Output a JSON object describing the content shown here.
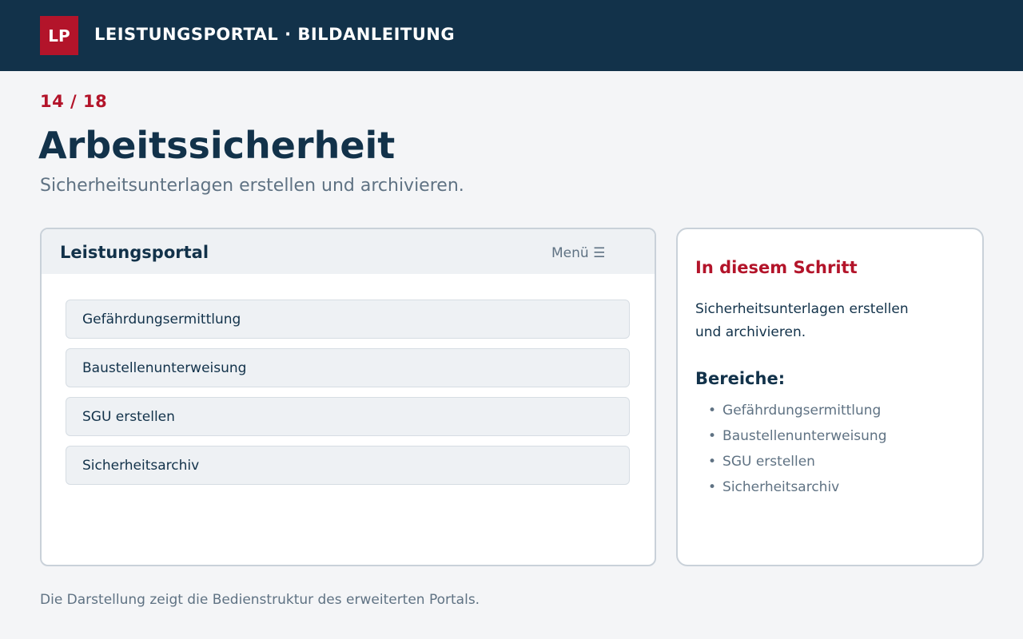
{
  "header": {
    "logo_text": "LP",
    "brand_title": "LEISTUNGSPORTAL · BILDANLEITUNG"
  },
  "step": {
    "counter": "14 / 18",
    "title": "Arbeitssicherheit",
    "subtitle": "Sicherheitsunterlagen erstellen und archivieren."
  },
  "portal": {
    "title": "Leistungsportal",
    "menu_label": "Menü ☰",
    "items": [
      {
        "label": "Gefährdungsermittlung"
      },
      {
        "label": "Baustellenunterweisung"
      },
      {
        "label": "SGU erstellen"
      },
      {
        "label": "Sicherheitsarchiv"
      }
    ]
  },
  "info": {
    "heading": "In diesem Schritt",
    "text": "Sicherheitsunterlagen erstellen und archivieren.",
    "areas_heading": "Bereiche:",
    "areas": [
      "Gefährdungsermittlung",
      "Baustellenunterweisung",
      "SGU erstellen",
      "Sicherheitsarchiv"
    ]
  },
  "footer": {
    "note": "Die Darstellung zeigt die Bedienstruktur des erweiterten Portals."
  },
  "colors": {
    "navy": "#12324a",
    "accent_red": "#b3142a",
    "muted_text": "#5f7283",
    "page_background": "#f4f5f7",
    "panel_header": "#eef1f4"
  }
}
